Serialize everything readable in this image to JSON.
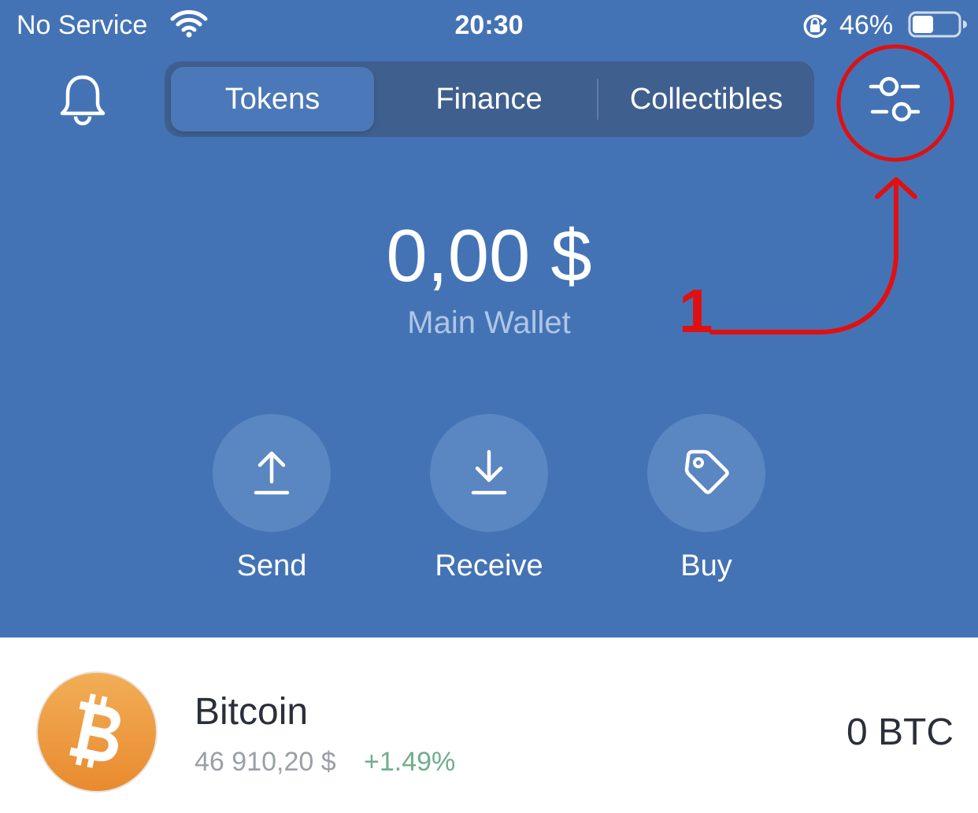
{
  "status_bar": {
    "carrier": "No Service",
    "time": "20:30",
    "battery_percent": "46%",
    "battery_level": 0.46,
    "icons": [
      "wifi-icon",
      "rotation-lock-icon",
      "battery-icon"
    ]
  },
  "header": {
    "notification_icon": "bell-icon",
    "tabs": [
      {
        "label": "Tokens",
        "active": true
      },
      {
        "label": "Finance",
        "active": false
      },
      {
        "label": "Collectibles",
        "active": false
      }
    ],
    "settings_icon": "sliders-icon"
  },
  "annotation": {
    "step_number": "1",
    "color": "#E01010"
  },
  "wallet": {
    "balance": "0,00 $",
    "name": "Main Wallet"
  },
  "actions": [
    {
      "label": "Send",
      "icon": "upload-arrow-icon"
    },
    {
      "label": "Receive",
      "icon": "download-arrow-icon"
    },
    {
      "label": "Buy",
      "icon": "price-tag-icon"
    }
  ],
  "tokens": [
    {
      "name": "Bitcoin",
      "price": "46 910,20 $",
      "change": "+1.49%",
      "balance": "0 BTC",
      "icon": "bitcoin-icon"
    }
  ],
  "colors": {
    "header_background": "#4473B5",
    "segment_background": "#3F5F8F",
    "segment_active": "#4B78B8",
    "action_button": "#5A86C2",
    "positive_change": "#6FAE8C",
    "bitcoin_orange": "#F09A3A"
  }
}
